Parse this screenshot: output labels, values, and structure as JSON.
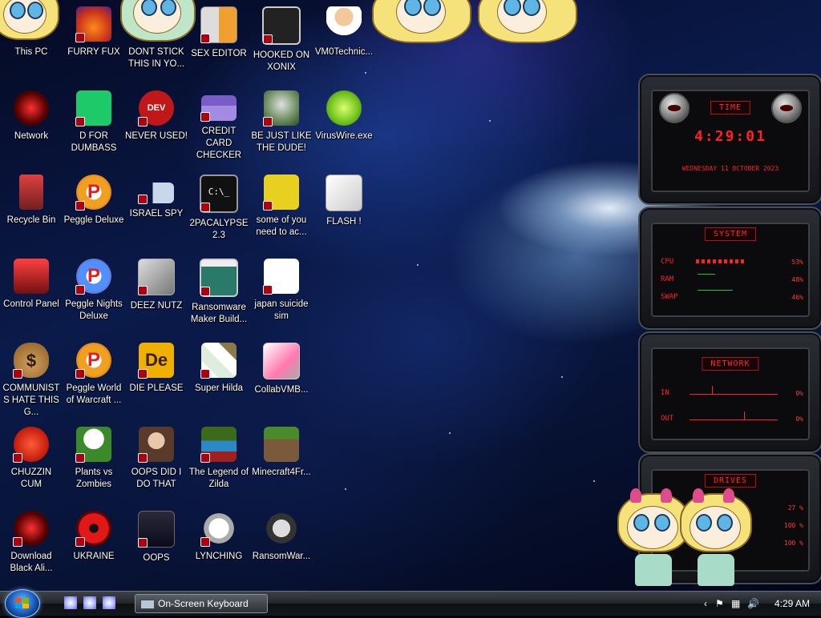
{
  "desktop": {
    "icons": [
      {
        "id": "this-pc",
        "label": "This PC"
      },
      {
        "id": "furry-fux",
        "label": "FURRY FUX"
      },
      {
        "id": "dont-stick",
        "label": "DONT STICK THIS IN YO..."
      },
      {
        "id": "sex-editor",
        "label": "SEX EDITOR"
      },
      {
        "id": "hooked-on-xonix",
        "label": "HOOKED ON XONIX"
      },
      {
        "id": "vm0technic",
        "label": "VM0Technic..."
      },
      {
        "id": "network",
        "label": "Network"
      },
      {
        "id": "d-for-dumbass",
        "label": "D FOR DUMBASS"
      },
      {
        "id": "never-used",
        "label": "NEVER USED!"
      },
      {
        "id": "credit-card-checker",
        "label": "CREDIT CARD CHECKER"
      },
      {
        "id": "be-just-like-the-dude",
        "label": "BE JUST LIKE THE DUDE!"
      },
      {
        "id": "viruswire",
        "label": "VirusWire.exe"
      },
      {
        "id": "recycle-bin",
        "label": "Recycle Bin"
      },
      {
        "id": "peggle-deluxe",
        "label": "Peggle Deluxe"
      },
      {
        "id": "israel-spy",
        "label": "ISRAEL SPY"
      },
      {
        "id": "2pacalypse",
        "label": "2PACALYPSE 2.3"
      },
      {
        "id": "some-of-you",
        "label": "some of you need to ac..."
      },
      {
        "id": "flash",
        "label": "FLASH !"
      },
      {
        "id": "control-panel",
        "label": "Control Panel"
      },
      {
        "id": "peggle-nights",
        "label": "Peggle Nights Deluxe"
      },
      {
        "id": "deez-nutz",
        "label": "DEEZ NUTZ"
      },
      {
        "id": "ransomware-maker",
        "label": "Ransomware Maker Build..."
      },
      {
        "id": "japan-suicide-sim",
        "label": "japan suicide sim"
      },
      {
        "id": "communists",
        "label": "COMMUNISTS HATE THIS G..."
      },
      {
        "id": "peggle-world-of-warcraft",
        "label": "Peggle World of Warcraft ..."
      },
      {
        "id": "die-please",
        "label": "DIE PLEASE"
      },
      {
        "id": "super-hilda",
        "label": "Super Hilda"
      },
      {
        "id": "collabvmb",
        "label": "CollabVMB..."
      },
      {
        "id": "chuzzin-cum",
        "label": "CHUZZIN CUM"
      },
      {
        "id": "plants-vs-zombies",
        "label": "Plants vs Zombies"
      },
      {
        "id": "oops-did-i-do-that",
        "label": "OOPS DID I DO THAT"
      },
      {
        "id": "legend-of-zilda",
        "label": "The Legend of Zilda"
      },
      {
        "id": "minecraft4fr",
        "label": "Minecraft4Fr..."
      },
      {
        "id": "download-black-ali",
        "label": "Download Black Ali..."
      },
      {
        "id": "ukraine",
        "label": "UKRAINE"
      },
      {
        "id": "oops",
        "label": "OOPS"
      },
      {
        "id": "lynching",
        "label": "LYNCHING"
      },
      {
        "id": "ransomwar",
        "label": "RansomWar..."
      }
    ]
  },
  "gadget": {
    "time": {
      "title": "TIME",
      "clock": "4:29:01",
      "date": "WEDNESDAY 11 OCTOBER 2023"
    },
    "system": {
      "title": "SYSTEM",
      "rows": [
        {
          "label": "CPU",
          "value": "53%",
          "level": 0.53
        },
        {
          "label": "RAM",
          "value": "48%",
          "level": 0.48
        },
        {
          "label": "SWAP",
          "value": "46%",
          "level": 0.46
        }
      ]
    },
    "network": {
      "title": "NETWORK",
      "rows": [
        {
          "label": "IN",
          "value": "0%"
        },
        {
          "label": "OUT",
          "value": "0%"
        }
      ]
    },
    "drives": {
      "title": "DRIVES",
      "rows": [
        {
          "value": "27 %"
        },
        {
          "value": "100 %"
        },
        {
          "value": "100 %"
        }
      ]
    }
  },
  "taskbar": {
    "task_label": "On-Screen Keyboard",
    "clock": "4:29 AM",
    "tray_chevron": "‹"
  },
  "colors": {
    "gadget_accent": "#ff2222",
    "taskbar": "#1c1f24"
  }
}
